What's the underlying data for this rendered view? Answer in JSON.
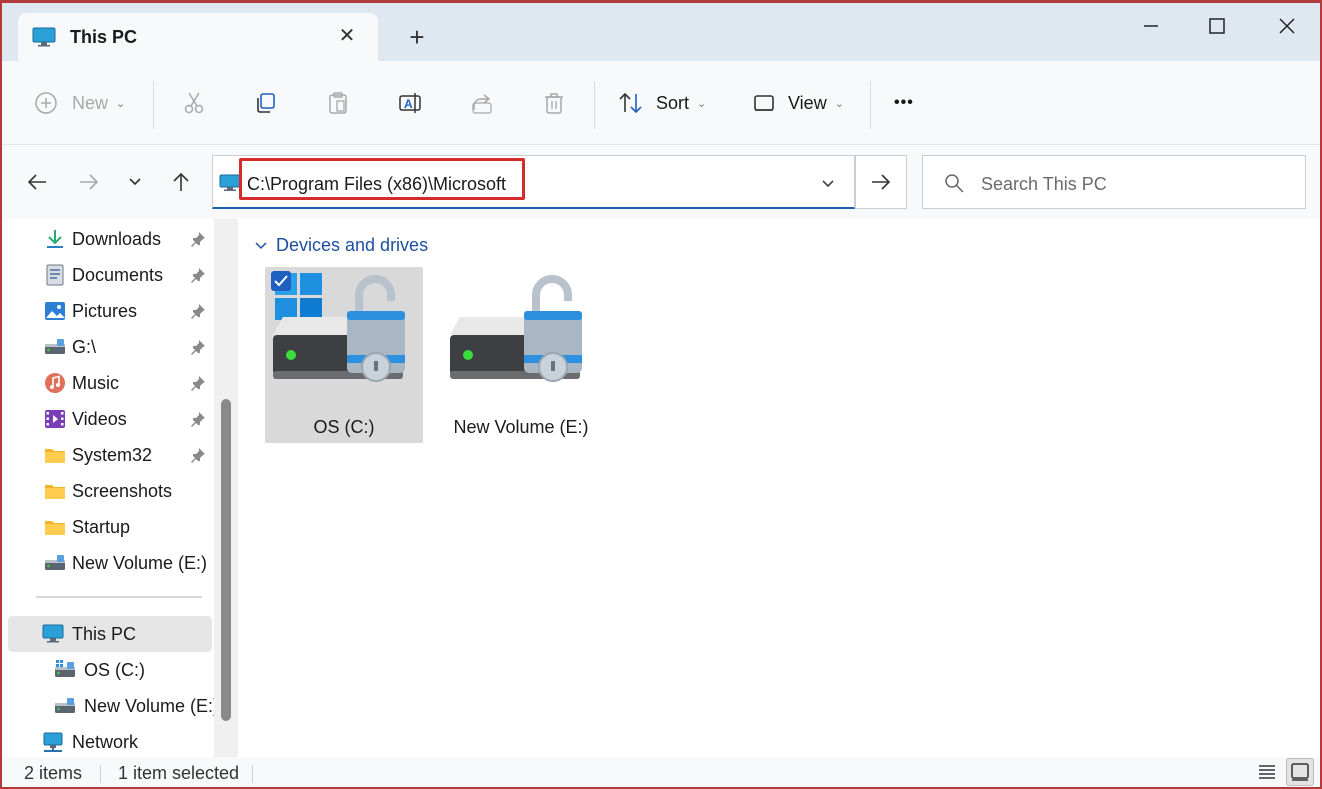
{
  "window": {
    "tab_title": "This PC",
    "tab_icon": "this-pc-icon",
    "controls": [
      "minimize-icon",
      "maximize-icon",
      "close-icon"
    ]
  },
  "toolbar": {
    "new_label": "New",
    "sort_label": "Sort",
    "view_label": "View",
    "more_label": "•••",
    "disabled_commands": [
      "new",
      "cut",
      "paste",
      "share",
      "delete"
    ]
  },
  "address": {
    "path": "C:\\Program Files (x86)\\Microsoft",
    "highlight_color": "#d62b2b"
  },
  "search": {
    "placeholder": "Search This PC"
  },
  "sidebar": {
    "quick_access": [
      {
        "label": "Downloads",
        "icon": "downloads-icon",
        "pinned": true
      },
      {
        "label": "Documents",
        "icon": "documents-icon",
        "pinned": true
      },
      {
        "label": "Pictures",
        "icon": "pictures-icon",
        "pinned": true
      },
      {
        "label": "G:\\",
        "icon": "drive-icon",
        "pinned": true
      },
      {
        "label": "Music",
        "icon": "music-icon",
        "pinned": true
      },
      {
        "label": "Videos",
        "icon": "videos-icon",
        "pinned": true
      },
      {
        "label": "System32",
        "icon": "folder-icon",
        "pinned": true
      },
      {
        "label": "Screenshots",
        "icon": "folder-icon",
        "pinned": false
      },
      {
        "label": "Startup",
        "icon": "folder-icon",
        "pinned": false
      },
      {
        "label": "New Volume (E:)",
        "icon": "drive-icon",
        "pinned": false
      }
    ],
    "tree": [
      {
        "label": "This PC",
        "icon": "this-pc-icon",
        "selected": true
      },
      {
        "label": "OS (C:)",
        "icon": "os-drive-icon",
        "selected": false
      },
      {
        "label": "New Volume (E:)",
        "icon": "drive-icon",
        "selected": false
      },
      {
        "label": "Network",
        "icon": "network-icon",
        "selected": false
      }
    ]
  },
  "content": {
    "group_title": "Devices and drives",
    "drives": [
      {
        "label": "OS (C:)",
        "selected": true,
        "icon": "bitlocker-os-drive-icon"
      },
      {
        "label": "New Volume (E:)",
        "selected": false,
        "icon": "bitlocker-drive-icon"
      }
    ]
  },
  "status": {
    "item_count": "2 items",
    "selection": "1 item selected"
  },
  "colors": {
    "accent": "#1f5fbf",
    "link_blue": "#1f4fa0",
    "titlebar": "#dfe8f0"
  }
}
